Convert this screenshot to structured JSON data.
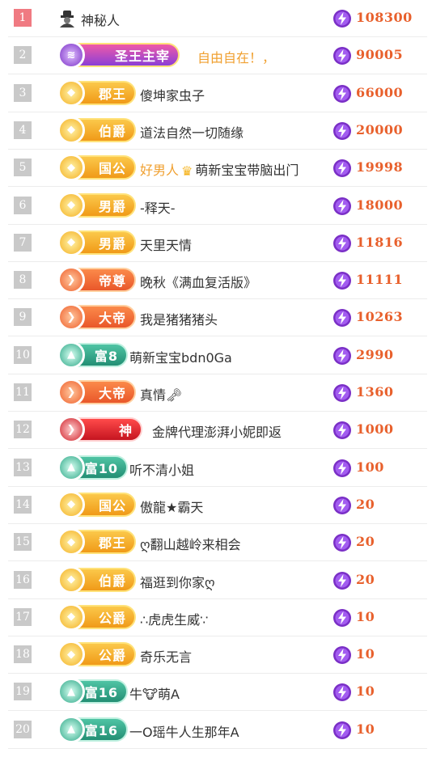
{
  "rows": [
    {
      "rank": "1",
      "badge": null,
      "name": "神秘人",
      "score": "108300",
      "first": true,
      "mystery": true
    },
    {
      "rank": "2",
      "badge": {
        "label": "圣王主宰",
        "style": "royal"
      },
      "name": "自由自在！，",
      "name_color": "#f0a030",
      "score": "90005"
    },
    {
      "rank": "3",
      "badge": {
        "label": "郡王",
        "style": "gold"
      },
      "name": "傻坤家虫子",
      "score": "66000"
    },
    {
      "rank": "4",
      "badge": {
        "label": "伯爵",
        "style": "gold"
      },
      "name": "道法自然一切随缘",
      "score": "20000"
    },
    {
      "rank": "5",
      "badge": {
        "label": "国公",
        "style": "gold"
      },
      "prefix": "好男人",
      "name": "萌新宝宝带脑出门",
      "score": "19998"
    },
    {
      "rank": "6",
      "badge": {
        "label": "男爵",
        "style": "gold"
      },
      "name": "-释天-",
      "score": "18000"
    },
    {
      "rank": "7",
      "badge": {
        "label": "男爵",
        "style": "gold"
      },
      "name": "天里天情",
      "score": "11816"
    },
    {
      "rank": "8",
      "badge": {
        "label": "帝尊",
        "style": "orange"
      },
      "name": "晚秋《满血复活版》",
      "score": "11111"
    },
    {
      "rank": "9",
      "badge": {
        "label": "大帝",
        "style": "orange"
      },
      "name": "我是猪猪猪头",
      "score": "10263"
    },
    {
      "rank": "10",
      "badge": {
        "label": "富8",
        "style": "green"
      },
      "name": "萌新宝宝bdn0Ga",
      "score": "2990"
    },
    {
      "rank": "11",
      "badge": {
        "label": "大帝",
        "style": "orange"
      },
      "name": "真情🗝",
      "score": "1360"
    },
    {
      "rank": "12",
      "badge": {
        "label": "神",
        "style": "red"
      },
      "name": "金牌代理澎湃小妮即返",
      "score": "1000"
    },
    {
      "rank": "13",
      "badge": {
        "label": "富10",
        "style": "green"
      },
      "name": "听不清小姐",
      "score": "100"
    },
    {
      "rank": "14",
      "badge": {
        "label": "国公",
        "style": "gold"
      },
      "name": "傲龍★霸天",
      "score": "20"
    },
    {
      "rank": "15",
      "badge": {
        "label": "郡王",
        "style": "gold"
      },
      "name": "ღ翻山越岭来相会",
      "score": "20"
    },
    {
      "rank": "16",
      "badge": {
        "label": "伯爵",
        "style": "gold"
      },
      "name": "福逛到你家ღ",
      "score": "20"
    },
    {
      "rank": "17",
      "badge": {
        "label": "公爵",
        "style": "gold"
      },
      "name": "∴虎虎生威∵",
      "score": "10"
    },
    {
      "rank": "18",
      "badge": {
        "label": "公爵",
        "style": "gold"
      },
      "name": "奇乐无言",
      "score": "10"
    },
    {
      "rank": "19",
      "badge": {
        "label": "富16",
        "style": "green"
      },
      "name": "牛🐮萌A",
      "score": "10"
    },
    {
      "rank": "20",
      "badge": {
        "label": "富16",
        "style": "green"
      },
      "name": "一O瑶牛人生那年A",
      "score": "10"
    }
  ],
  "colors": {
    "score": "#e8602c",
    "gold_fill": "#f5a623",
    "orange_fill": "#f06a2a",
    "green_fill": "#2fa888",
    "red_fill": "#e0222a",
    "royal_fill": "#8a3fd6",
    "icon_purple": "#8a3fd6"
  }
}
